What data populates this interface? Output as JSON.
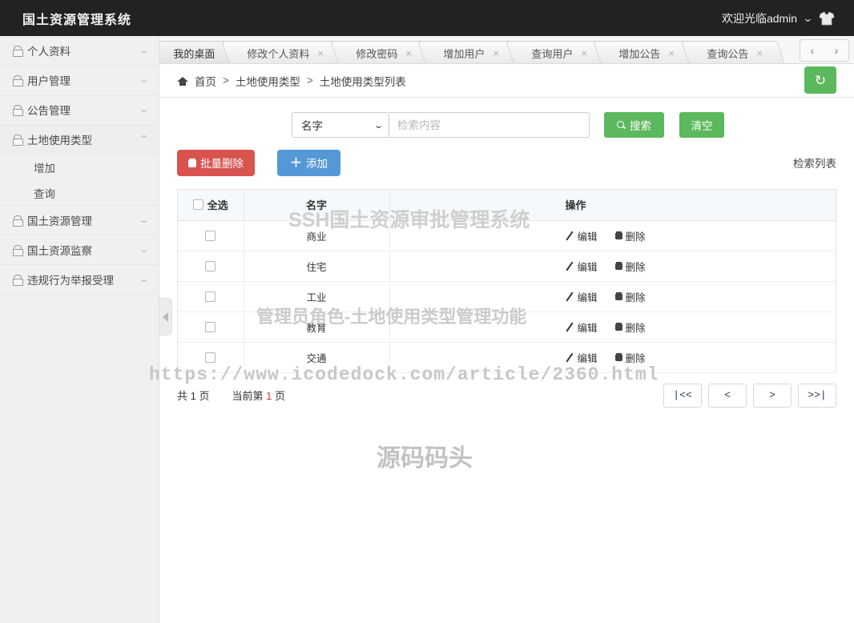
{
  "topbar": {
    "brand": "国土资源管理系统",
    "welcome": "欢迎光临admin",
    "caret": "⌄",
    "avatar_icon": "shirt-icon"
  },
  "sidebar": {
    "items": [
      {
        "label": "个人资料",
        "arrow": "⌄",
        "expanded": false
      },
      {
        "label": "用户管理",
        "arrow": "⌄",
        "expanded": false
      },
      {
        "label": "公告管理",
        "arrow": "⌄",
        "expanded": false
      },
      {
        "label": "土地使用类型",
        "arrow": "⌃",
        "expanded": true
      },
      {
        "label": "国土资源管理",
        "arrow": "⌄",
        "expanded": false
      },
      {
        "label": "国土资源监察",
        "arrow": "⌄",
        "expanded": false
      },
      {
        "label": "违规行为举报受理",
        "arrow": "⌄",
        "expanded": false
      }
    ],
    "sub_items": [
      {
        "label": "增加"
      },
      {
        "label": "查询"
      }
    ]
  },
  "tabs": {
    "items": [
      {
        "label": "我的桌面",
        "closable": false,
        "active": true
      },
      {
        "label": "修改个人资料",
        "closable": true,
        "active": false
      },
      {
        "label": "修改密码",
        "closable": true,
        "active": false
      },
      {
        "label": "增加用户",
        "closable": true,
        "active": false
      },
      {
        "label": "查询用户",
        "closable": true,
        "active": false
      },
      {
        "label": "增加公告",
        "closable": true,
        "active": false
      },
      {
        "label": "查询公告",
        "closable": true,
        "active": false
      }
    ],
    "close_glyph": "×",
    "prev": "‹",
    "next": "›"
  },
  "breadcrumb": {
    "home": "首页",
    "sep": ">",
    "level2": "土地使用类型",
    "level3": "土地使用类型列表",
    "refresh_icon": "↻"
  },
  "search": {
    "field_label": "名字",
    "field_caret": "⌄",
    "placeholder": "检索内容",
    "value": "",
    "search_label": "搜索",
    "clear_label": "清空"
  },
  "actions": {
    "batch_delete": "批量删除",
    "add": "添加",
    "add_plus": "＋",
    "list_label": "检索列表"
  },
  "table": {
    "headers": {
      "select_all": "全选",
      "name": "名字",
      "operation": "操作"
    },
    "rows": [
      {
        "name": "商业",
        "edit": "编辑",
        "delete": "删除",
        "checked": false
      },
      {
        "name": "住宅",
        "edit": "编辑",
        "delete": "删除",
        "checked": false
      },
      {
        "name": "工业",
        "edit": "编辑",
        "delete": "删除",
        "checked": false
      },
      {
        "name": "教育",
        "edit": "编辑",
        "delete": "删除",
        "checked": false
      },
      {
        "name": "交通",
        "edit": "编辑",
        "delete": "删除",
        "checked": false
      }
    ]
  },
  "pagination": {
    "total_prefix": "共",
    "total_pages": "1",
    "total_suffix": "页",
    "current_prefix": "当前第",
    "current_page": "1",
    "current_suffix": "页",
    "first": "|<<",
    "prev": "<",
    "next": ">",
    "last": ">>|"
  },
  "watermarks": {
    "title": "SSH国土资源审批管理系统",
    "role": "管理员角色-土地使用类型管理功能",
    "url": "https://www.icodedock.com/article/2360.html",
    "site": "源码码头"
  },
  "colors": {
    "header_bg": "#222222",
    "green": "#5cb85c",
    "red": "#d9534f",
    "blue": "#5598d6",
    "page_red": "#c0392b"
  }
}
